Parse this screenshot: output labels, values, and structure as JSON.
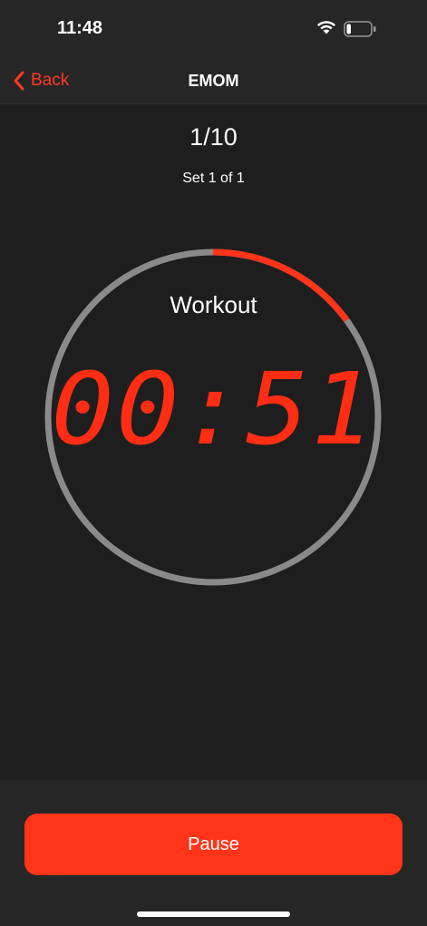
{
  "status": {
    "time": "11:48",
    "battery_level": 0.15
  },
  "nav": {
    "back_label": "Back",
    "title": "EMOM"
  },
  "timer": {
    "round": "1/10",
    "set": "Set 1 of 1",
    "phase": "Workout",
    "time": "00:51",
    "progress": 0.15
  },
  "actions": {
    "pause_label": "Pause"
  },
  "colors": {
    "accent": "#ff3419",
    "ring_track": "#8a8a8a",
    "background": "#1e1e1e",
    "bar": "#262626"
  }
}
